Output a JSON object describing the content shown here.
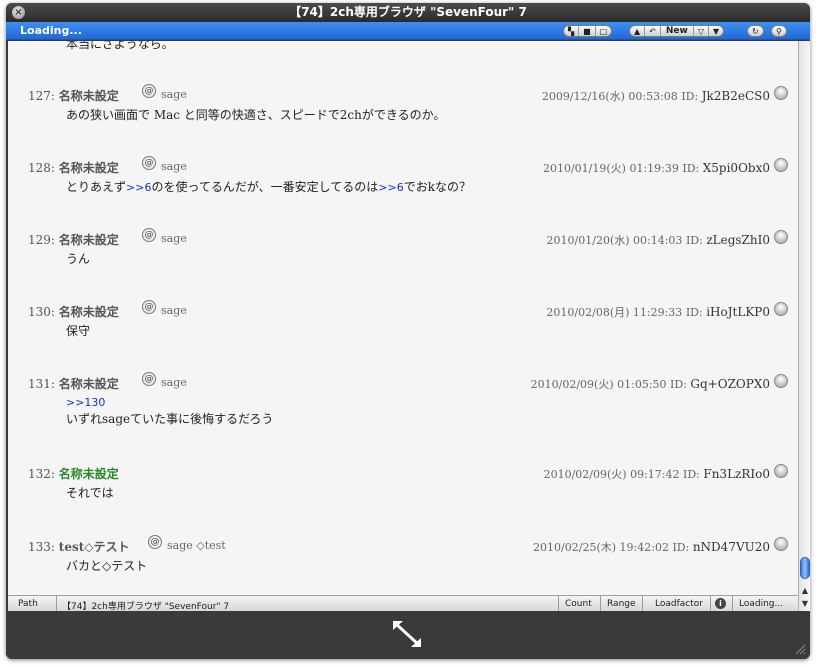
{
  "window": {
    "title": "【74】2ch専用ブラウザ \"SevenFour\" 7"
  },
  "toolbar": {
    "loading_label": "Loading...",
    "new_label": "New"
  },
  "previous_post_tail": "本当にさようなら。",
  "posts": [
    {
      "num": "127:",
      "name": "名称未設定",
      "name_color": "#555555",
      "mail": "sage",
      "date": "2009/12/16(水) 00:53:08",
      "id_label": "ID:",
      "id": "Jk2B2eCS0",
      "lines": [
        "あの狭い画面で Mac と同等の快適さ、スピードで2chができるのか。"
      ]
    },
    {
      "num": "128:",
      "name": "名称未設定",
      "name_color": "#555555",
      "mail": "sage",
      "date": "2010/01/19(火) 01:19:39",
      "id_label": "ID:",
      "id": "X5pi0Obx0",
      "line_parts": [
        "とりあえず",
        ">>6",
        "のを使ってるんだが、一番安定してるのは",
        ">>6",
        "でおkなの？"
      ]
    },
    {
      "num": "129:",
      "name": "名称未設定",
      "name_color": "#555555",
      "mail": "sage",
      "date": "2010/01/20(水) 00:14:03",
      "id_label": "ID:",
      "id": "zLegsZhI0",
      "lines": [
        "うん"
      ]
    },
    {
      "num": "130:",
      "name": "名称未設定",
      "name_color": "#555555",
      "mail": "sage",
      "date": "2010/02/08(月) 11:29:33",
      "id_label": "ID:",
      "id": "iHoJtLKP0",
      "lines": [
        "保守"
      ]
    },
    {
      "num": "131:",
      "name": "名称未設定",
      "name_color": "#555555",
      "mail": "sage",
      "date": "2010/02/09(火) 01:05:50",
      "id_label": "ID:",
      "id": "Gq+OZOPX0",
      "anchor": ">>130",
      "lines": [
        "いずれsageていた事に後悔するだろう"
      ]
    },
    {
      "num": "132:",
      "name": "名称未設定",
      "name_color": "#2a8a2a",
      "mail": "",
      "date": "2010/02/09(火) 09:17:42",
      "id_label": "ID:",
      "id": "Fn3LzRIo0",
      "lines": [
        "それでは"
      ]
    },
    {
      "num": "133:",
      "name": "test◇テスト",
      "name_color": "#555555",
      "mail": "sage ◇test",
      "date": "2010/02/25(木) 19:42:02",
      "id_label": "ID:",
      "id": "nND47VU20",
      "lines": [
        "バカと◇テスト"
      ]
    }
  ],
  "statusbar": {
    "path_label": "Path",
    "path_value": "【74】2ch専用ブラウザ \"SevenFour\" 7",
    "count_label": "Count",
    "range_label": "Range",
    "loadfactor_label": "Loadfactor",
    "loading_label": "Loading..."
  },
  "colors": {
    "accent": "#2a74e2",
    "anchor": "#1530d0",
    "green_name": "#2a8a2a"
  }
}
